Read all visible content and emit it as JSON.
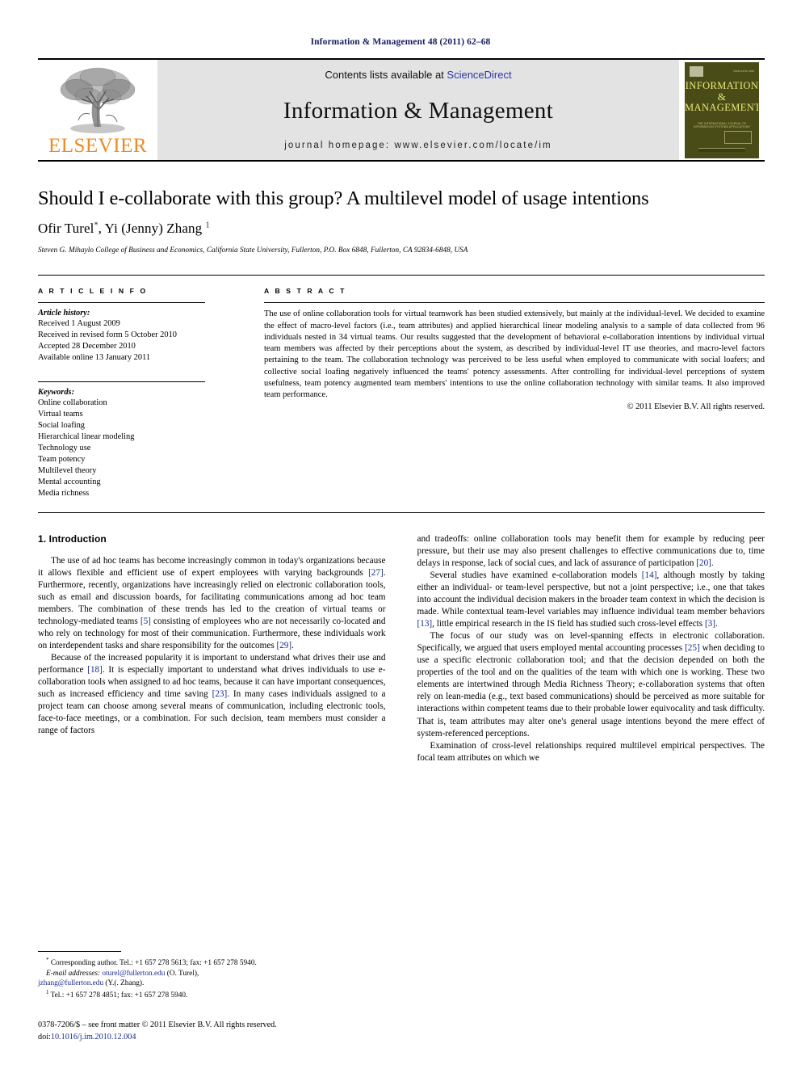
{
  "running_head": "Information & Management 48 (2011) 62–68",
  "masthead": {
    "publisher_name": "ELSEVIER",
    "contents_prefix": "Contents lists available at ",
    "contents_link": "ScienceDirect",
    "journal_name": "Information & Management",
    "homepage_line": "journal homepage: www.elsevier.com/locate/im",
    "cover": {
      "line1": "INFORMATION",
      "amp": "&",
      "line2": "MANAGEMENT",
      "subtitle": "THE INTERNATIONAL JOURNAL OF INFORMATION SYSTEMS APPLICATIONS",
      "top_left_tiny": "ELSEVIER",
      "top_right_tiny": "ISSN 0378-7206"
    }
  },
  "article": {
    "title": "Should I e-collaborate with this group? A multilevel model of usage intentions",
    "authors": "Ofir Turel",
    "author_star": "*",
    "authors_second": ", Yi (Jenny) Zhang ",
    "author_sup": "1",
    "affiliation": "Steven G. Mihaylo College of Business and Economics, California State University, Fullerton, P.O. Box 6848, Fullerton, CA 92834-6848, USA"
  },
  "info": {
    "label": "A R T I C L E   I N F O",
    "history_title": "Article history:",
    "history": [
      "Received 1 August 2009",
      "Received in revised form 5 October 2010",
      "Accepted 28 December 2010",
      "Available online 13 January 2011"
    ],
    "keywords_title": "Keywords:",
    "keywords": [
      "Online collaboration",
      "Virtual teams",
      "Social loafing",
      "Hierarchical linear modeling",
      "Technology use",
      "Team potency",
      "Multilevel theory",
      "Mental accounting",
      "Media richness"
    ]
  },
  "abstract": {
    "label": "A B S T R A C T",
    "text": "The use of online collaboration tools for virtual teamwork has been studied extensively, but mainly at the individual-level. We decided to examine the effect of macro-level factors (i.e., team attributes) and applied hierarchical linear modeling analysis to a sample of data collected from 96 individuals nested in 34 virtual teams. Our results suggested that the development of behavioral e-collaboration intentions by individual virtual team members was affected by their perceptions about the system, as described by individual-level IT use theories, and macro-level factors pertaining to the team. The collaboration technology was perceived to be less useful when employed to communicate with social loafers; and collective social loafing negatively influenced the teams' potency assessments. After controlling for individual-level perceptions of system usefulness, team potency augmented team members' intentions to use the online collaboration technology with similar teams. It also improved team performance.",
    "copyright": "© 2011 Elsevier B.V. All rights reserved."
  },
  "body": {
    "section_heading": "1. Introduction",
    "left_paragraphs": [
      "The use of ad hoc teams has become increasingly common in today's organizations because it allows flexible and efficient use of expert employees with varying backgrounds [27]. Furthermore, recently, organizations have increasingly relied on electronic collaboration tools, such as email and discussion boards, for facilitating communications among ad hoc team members. The combination of these trends has led to the creation of virtual teams or technology-mediated teams [5] consisting of employees who are not necessarily co-located and who rely on technology for most of their communication. Furthermore, these individuals work on interdependent tasks and share responsibility for the outcomes [29].",
      "Because of the increased popularity it is important to understand what drives their use and performance [18]. It is especially important to understand what drives individuals to use e-collaboration tools when assigned to ad hoc teams, because it can have important consequences, such as increased efficiency and time saving [23]. In many cases individuals assigned to a project team can choose among several means of communication, including electronic tools, face-to-face meetings, or a combination. For such decision, team members must consider a range of factors"
    ],
    "right_paragraphs": [
      "and tradeoffs: online collaboration tools may benefit them for example by reducing peer pressure, but their use may also present challenges to effective communications due to, time delays in response, lack of social cues, and lack of assurance of participation [20].",
      "Several studies have examined e-collaboration models [14], although mostly by taking either an individual- or team-level perspective, but not a joint perspective; i.e., one that takes into account the individual decision makers in the broader team context in which the decision is made. While contextual team-level variables may influence individual team member behaviors [13], little empirical research in the IS field has studied such cross-level effects [3].",
      "The focus of our study was on level-spanning effects in electronic collaboration. Specifically, we argued that users employed mental accounting processes [25] when deciding to use a specific electronic collaboration tool; and that the decision depended on both the properties of the tool and on the qualities of the team with which one is working. These two elements are intertwined through Media Richness Theory; e-collaboration systems that often rely on lean-media (e.g., text based communications) should be perceived as more suitable for interactions within competent teams due to their probable lower equivocality and task difficulty. That is, team attributes may alter one's general usage intentions beyond the mere effect of system-referenced perceptions.",
      "Examination of cross-level relationships required multilevel empirical perspectives. The focal team attributes on which we"
    ]
  },
  "footnotes": {
    "corresponding": "Corresponding author. Tel.: +1 657 278 5613; fax: +1 657 278 5940.",
    "email_label": "E-mail addresses:",
    "email1": "oturel@fullerton.edu",
    "email1_name": " (O. Turel),",
    "email2": "jzhang@fullerton.edu",
    "email2_name": " (Y.(. Zhang).",
    "second_author_note": "Tel.: +1 657 278 4851; fax: +1 657 278 5940.",
    "star": "*",
    "one": "1"
  },
  "imprint": {
    "issn_line": "0378-7206/$ – see front matter © 2011 Elsevier B.V. All rights reserved.",
    "doi_label": "doi:",
    "doi_value": "10.1016/j.im.2010.12.004"
  },
  "colors": {
    "elsevier_orange": "#ED8B22",
    "link_blue": "#2b36a8",
    "citation_blue": "#1a2a8c",
    "running_head_navy": "#1a2060",
    "masthead_gray": "#e3e3e3",
    "cover_olive": "#4a4c18",
    "cover_yellow": "#e9e87a"
  }
}
